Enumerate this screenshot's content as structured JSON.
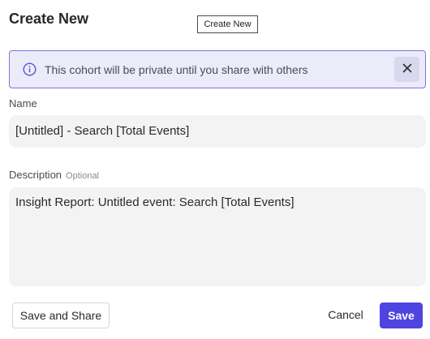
{
  "dialog": {
    "title": "Create New",
    "tooltip": "Create New"
  },
  "banner": {
    "icon": "info-icon",
    "message": "This cohort will be private until you share with others",
    "close_icon": "close-icon",
    "accent_color": "#7b74e0",
    "background_color": "#ecebfa"
  },
  "name_field": {
    "label": "Name",
    "value": "[Untitled] - Search [Total Events]"
  },
  "description_field": {
    "label": "Description",
    "optional_label": "Optional",
    "value": "Insight Report: Untitled event: Search [Total Events]"
  },
  "actions": {
    "save_and_share_label": "Save and Share",
    "cancel_label": "Cancel",
    "save_label": "Save",
    "primary_color": "#4f44e0"
  }
}
